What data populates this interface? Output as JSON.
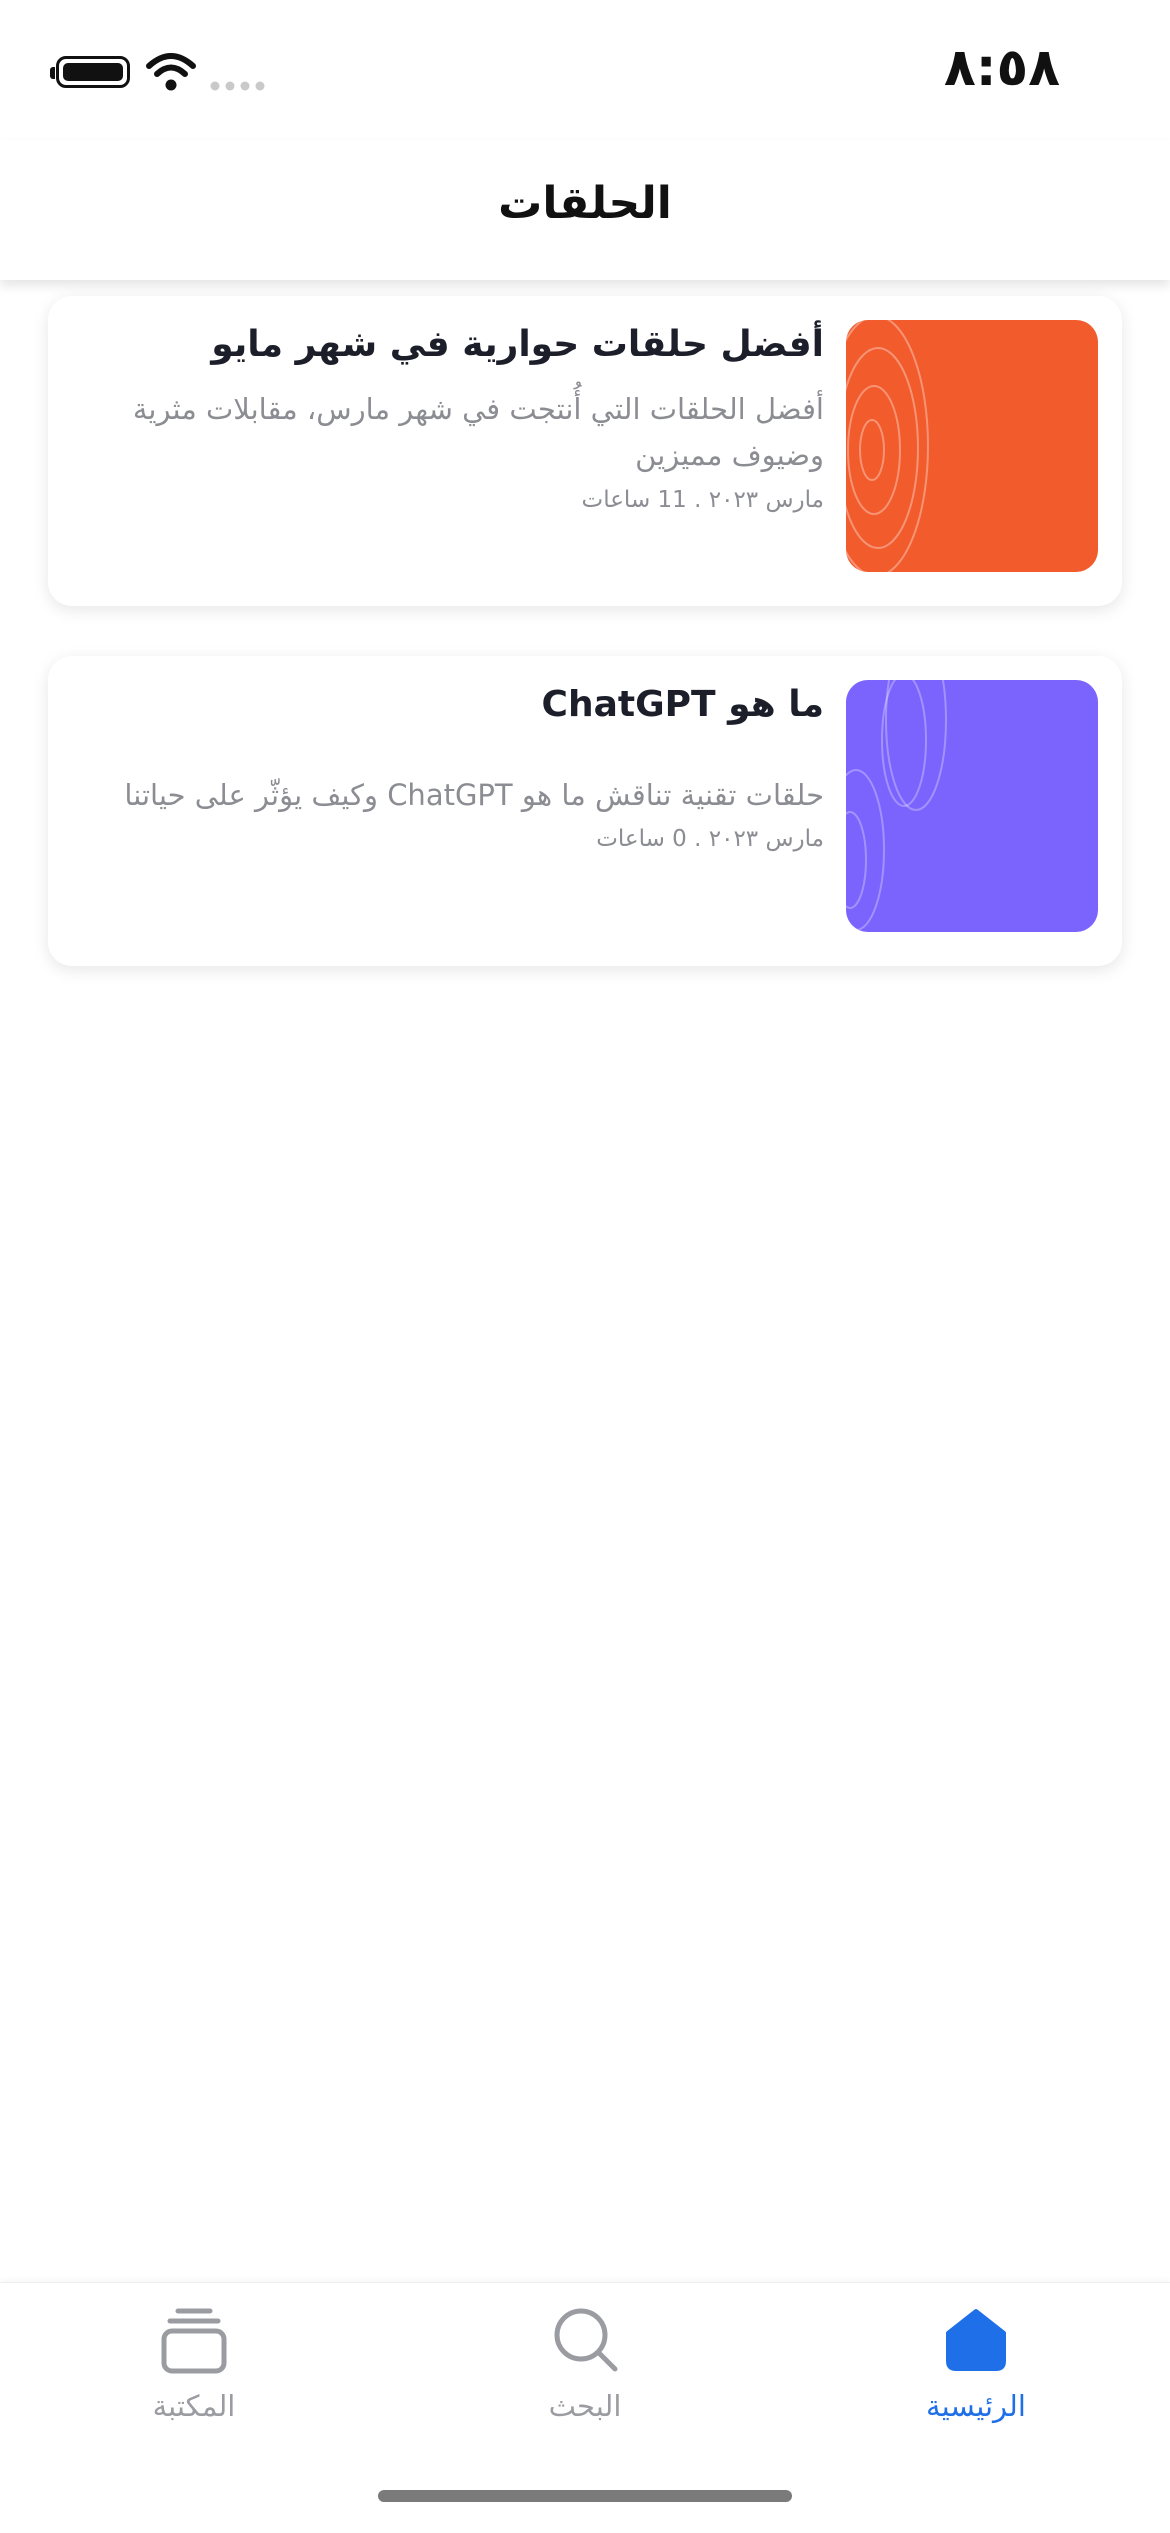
{
  "status_bar": {
    "time": "٨:٥٨",
    "battery_icon": "battery-icon",
    "wifi_icon": "wifi-icon",
    "signal_icon": "signal-icon"
  },
  "header": {
    "title": "الحلقات"
  },
  "episodes": [
    {
      "title": "أفضل حلقات حوارية في شهر مايو",
      "description": "أفضل الحلقات التي أُنتجت في شهر مارس، مقابلات مثرية وضيوف مميزين",
      "meta": "مارس ٢٠٢٣ . 11 ساعات",
      "thumb_color": "#f25b2c"
    },
    {
      "title": "ما هو ChatGPT",
      "description": "حلقات تقنية تناقش ما هو ChatGPT وكيف يؤثّر على حياتنا",
      "meta": "مارس ٢٠٢٣ . 0 ساعات",
      "thumb_color": "#7b63fe"
    }
  ],
  "tab_bar": {
    "home": {
      "label": "الرئيسية",
      "icon": "home-icon",
      "active": true
    },
    "search": {
      "label": "البحث",
      "icon": "search-icon",
      "active": false
    },
    "library": {
      "label": "المكتبة",
      "icon": "library-icon",
      "active": false
    },
    "active_color": "#1f6fe8",
    "inactive_color": "#9a9ca1"
  }
}
